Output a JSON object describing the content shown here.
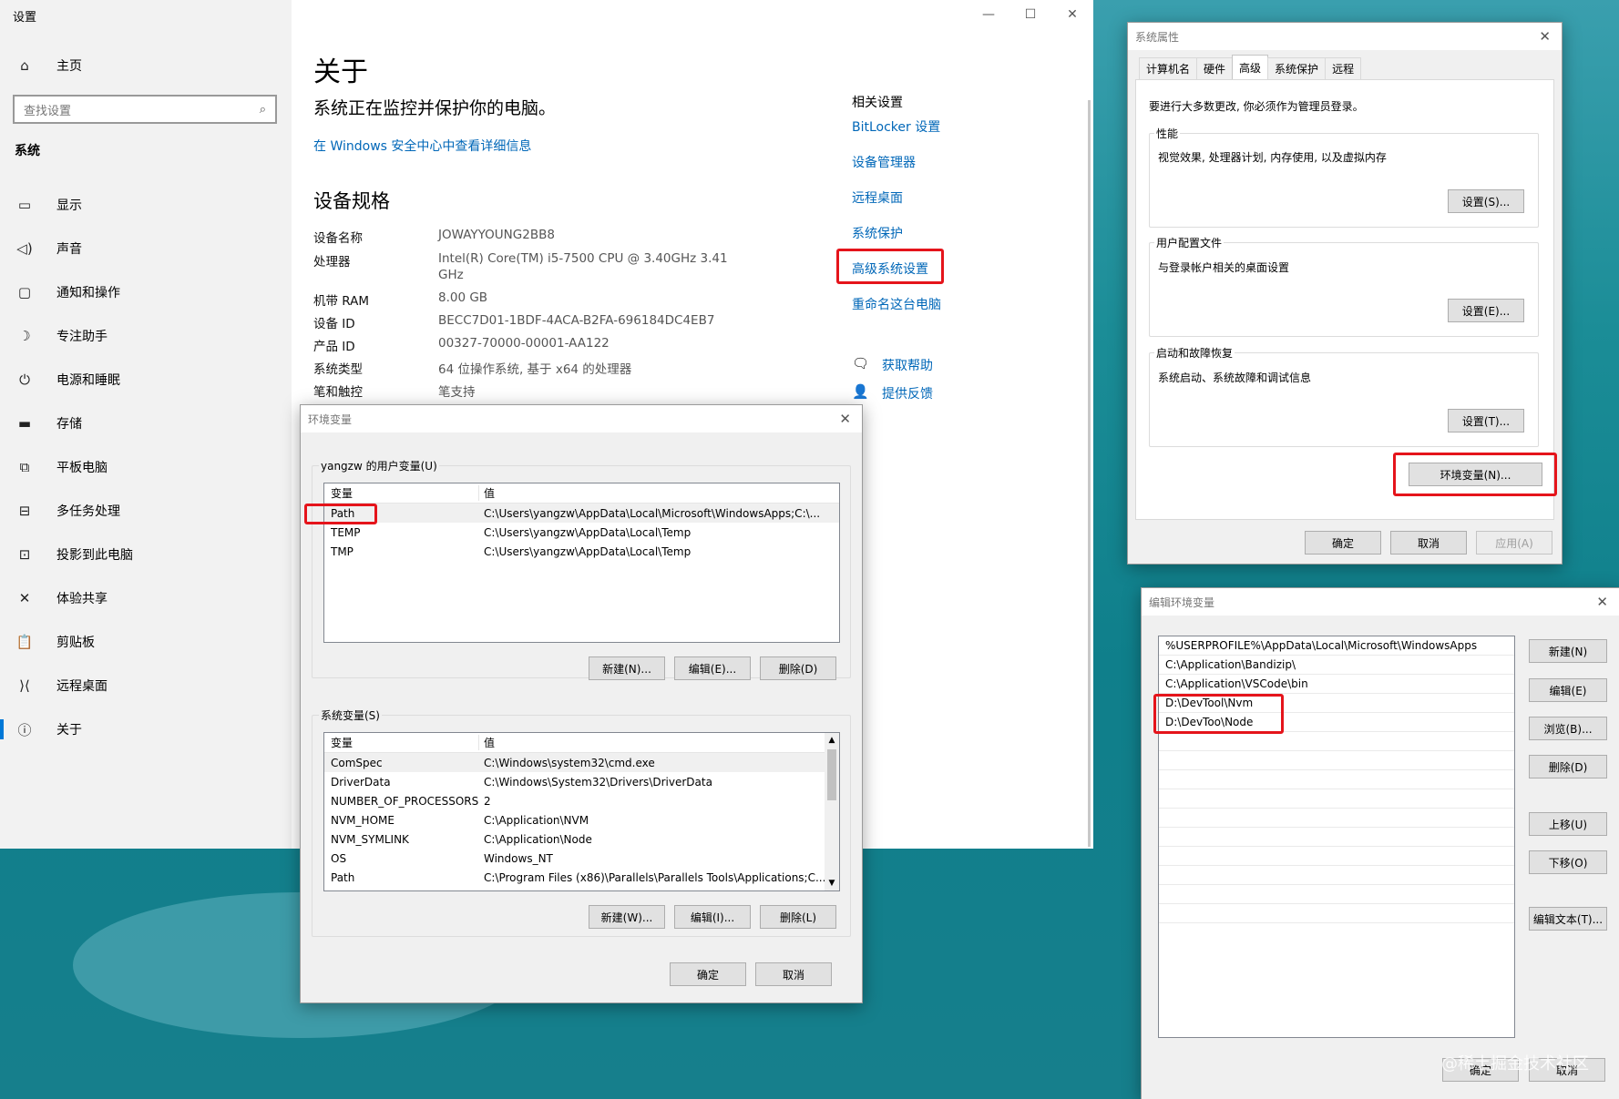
{
  "settings": {
    "app_title": "设置",
    "nav": {
      "home": "主页",
      "search_placeholder": "查找设置",
      "section": "系统",
      "items": [
        "显示",
        "声音",
        "通知和操作",
        "专注助手",
        "电源和睡眠",
        "存储",
        "平板电脑",
        "多任务处理",
        "投影到此电脑",
        "体验共享",
        "剪贴板",
        "远程桌面",
        "关于"
      ]
    },
    "window_buttons": [
      "—",
      "☐",
      "✕"
    ],
    "about": {
      "title": "关于",
      "status": "系统正在监控并保护你的电脑。",
      "security_link": "在 Windows 安全中心中查看详细信息",
      "specs_title": "设备规格",
      "specs": [
        {
          "label": "设备名称",
          "value": "JOWAYYOUNG2BB8"
        },
        {
          "label": "处理器",
          "value": "Intel(R) Core(TM) i5-7500 CPU @ 3.40GHz   3.41"
        },
        {
          "label": "",
          "value": "GHz"
        },
        {
          "label": "机带 RAM",
          "value": "8.00 GB"
        },
        {
          "label": "设备 ID",
          "value": "BECC7D01-1BDF-4ACA-B2FA-696184DC4EB7"
        },
        {
          "label": "产品 ID",
          "value": "00327-70000-00001-AA122"
        },
        {
          "label": "系统类型",
          "value": "64 位操作系统, 基于 x64 的处理器"
        },
        {
          "label": "笔和触控",
          "value": "笔支持"
        }
      ]
    },
    "related": {
      "title": "相关设置",
      "links": [
        "BitLocker 设置",
        "设备管理器",
        "远程桌面",
        "系统保护",
        "高级系统设置",
        "重命名这台电脑"
      ],
      "help": "获取帮助",
      "feedback": "提供反馈"
    }
  },
  "sysprops": {
    "title": "系统属性",
    "tabs": [
      "计算机名",
      "硬件",
      "高级",
      "系统保护",
      "远程"
    ],
    "active_tab": "高级",
    "admin_note": "要进行大多数更改, 你必须作为管理员登录。",
    "performance": {
      "label": "性能",
      "desc": "视觉效果, 处理器计划, 内存使用, 以及虚拟内存",
      "button": "设置(S)..."
    },
    "profiles": {
      "label": "用户配置文件",
      "desc": "与登录帐户相关的桌面设置",
      "button": "设置(E)..."
    },
    "startup": {
      "label": "启动和故障恢复",
      "desc": "系统启动、系统故障和调试信息",
      "button": "设置(T)..."
    },
    "env_button": "环境变量(N)...",
    "ok": "确定",
    "cancel": "取消",
    "apply": "应用(A)"
  },
  "envvars": {
    "title": "环境变量",
    "user_label": "yangzw 的用户变量(U)",
    "col_var": "变量",
    "col_val": "值",
    "user_vars": [
      {
        "name": "Path",
        "value": "C:\\Users\\yangzw\\AppData\\Local\\Microsoft\\WindowsApps;C:\\..."
      },
      {
        "name": "TEMP",
        "value": "C:\\Users\\yangzw\\AppData\\Local\\Temp"
      },
      {
        "name": "TMP",
        "value": "C:\\Users\\yangzw\\AppData\\Local\\Temp"
      }
    ],
    "user_buttons": [
      "新建(N)...",
      "编辑(E)...",
      "删除(D)"
    ],
    "sys_label": "系统变量(S)",
    "sys_vars": [
      {
        "name": "ComSpec",
        "value": "C:\\Windows\\system32\\cmd.exe"
      },
      {
        "name": "DriverData",
        "value": "C:\\Windows\\System32\\Drivers\\DriverData"
      },
      {
        "name": "NUMBER_OF_PROCESSORS",
        "value": "2"
      },
      {
        "name": "NVM_HOME",
        "value": "C:\\Application\\NVM"
      },
      {
        "name": "NVM_SYMLINK",
        "value": "C:\\Application\\Node"
      },
      {
        "name": "OS",
        "value": "Windows_NT"
      },
      {
        "name": "Path",
        "value": "C:\\Program Files (x86)\\Parallels\\Parallels Tools\\Applications;C..."
      }
    ],
    "sys_buttons": [
      "新建(W)...",
      "编辑(I)...",
      "删除(L)"
    ],
    "ok": "确定",
    "cancel": "取消"
  },
  "editenv": {
    "title": "编辑环境变量",
    "entries": [
      "%USERPROFILE%\\AppData\\Local\\Microsoft\\WindowsApps",
      "C:\\Application\\Bandizip\\",
      "C:\\Application\\VSCode\\bin",
      "D:\\DevTool\\Nvm",
      "D:\\DevToo\\Node"
    ],
    "buttons": [
      "新建(N)",
      "编辑(E)",
      "浏览(B)...",
      "删除(D)",
      "上移(U)",
      "下移(O)",
      "编辑文本(T)..."
    ],
    "ok": "确定",
    "cancel": "取消"
  },
  "watermark": "@稀土掘金技术社区",
  "colors": {
    "accent": "#0078d7",
    "link": "#0067b8",
    "highlight": "#e5141b"
  }
}
